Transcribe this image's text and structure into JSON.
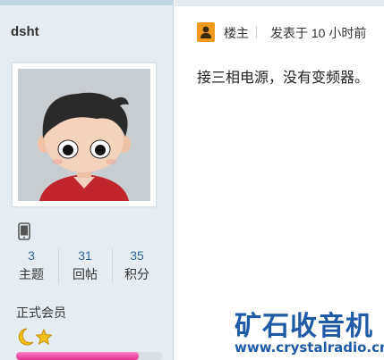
{
  "user": {
    "name": "dsht",
    "avatar_icon": "cartoon-boy-avatar",
    "device_icon": "mobile-phone-icon",
    "stats": [
      {
        "value": "3",
        "label": "主题"
      },
      {
        "value": "31",
        "label": "回帖"
      },
      {
        "value": "35",
        "label": "积分"
      }
    ],
    "group": "正式会员",
    "rank_icons": [
      "moon-icon",
      "star-icon"
    ],
    "level_progress": 0.84
  },
  "post": {
    "op_label": "楼主",
    "posted_time": "发表于 10 小时前 ",
    "content": "接三相电源，没有变频器。"
  },
  "watermark": {
    "title": "矿石收音机",
    "url": "www.crystalradio.cn"
  },
  "colors": {
    "sidebar_bg": "#e5edf2",
    "link_blue": "#336699",
    "progress_pink": "#e0308f",
    "watermark_blue": "#1e5aa6"
  }
}
